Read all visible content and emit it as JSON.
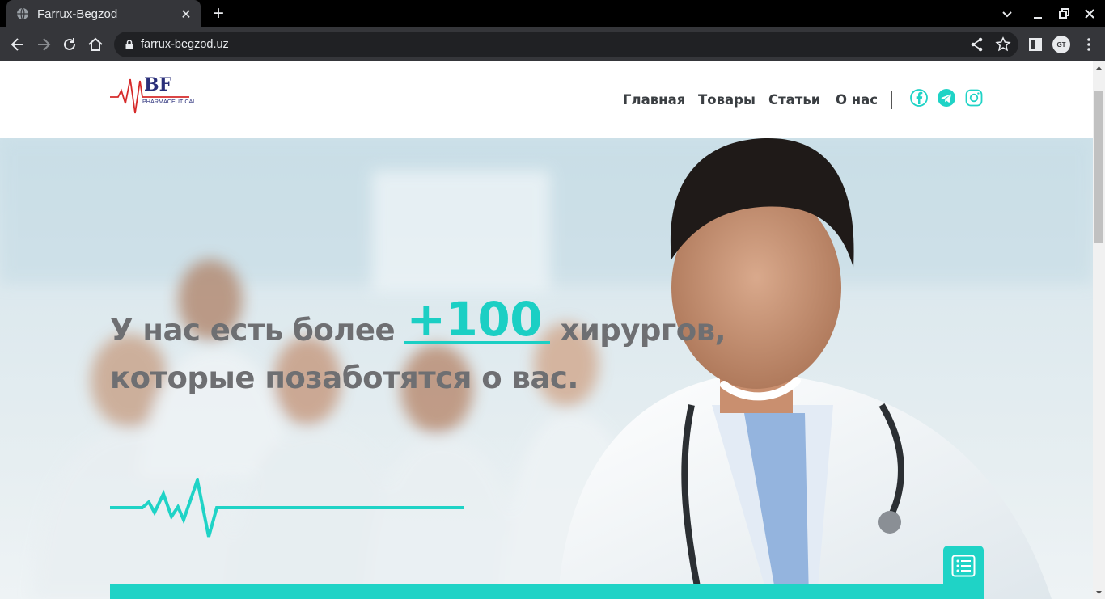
{
  "browser": {
    "tab_title": "Farrux-Begzod",
    "url": "farrux-begzod.uz",
    "profile_initials": "GT"
  },
  "site": {
    "logo": {
      "letters": "BF",
      "subtitle": "PHARMACEUTICALS"
    },
    "nav": [
      {
        "label": "Главная"
      },
      {
        "label": "Товары"
      },
      {
        "label": "Статьи"
      },
      {
        "label": "О нас"
      }
    ],
    "social_icons": [
      "facebook-icon",
      "telegram-icon",
      "instagram-icon"
    ]
  },
  "hero": {
    "heading_before": "У нас есть более ",
    "heading_highlight": "+100",
    "heading_after": " хирургов, которые позаботятся о вас."
  },
  "colors": {
    "accent": "#1fd3c6",
    "heading_text": "#6e6f72",
    "logo_red": "#d62b2b",
    "logo_navy": "#2a2f7a"
  }
}
